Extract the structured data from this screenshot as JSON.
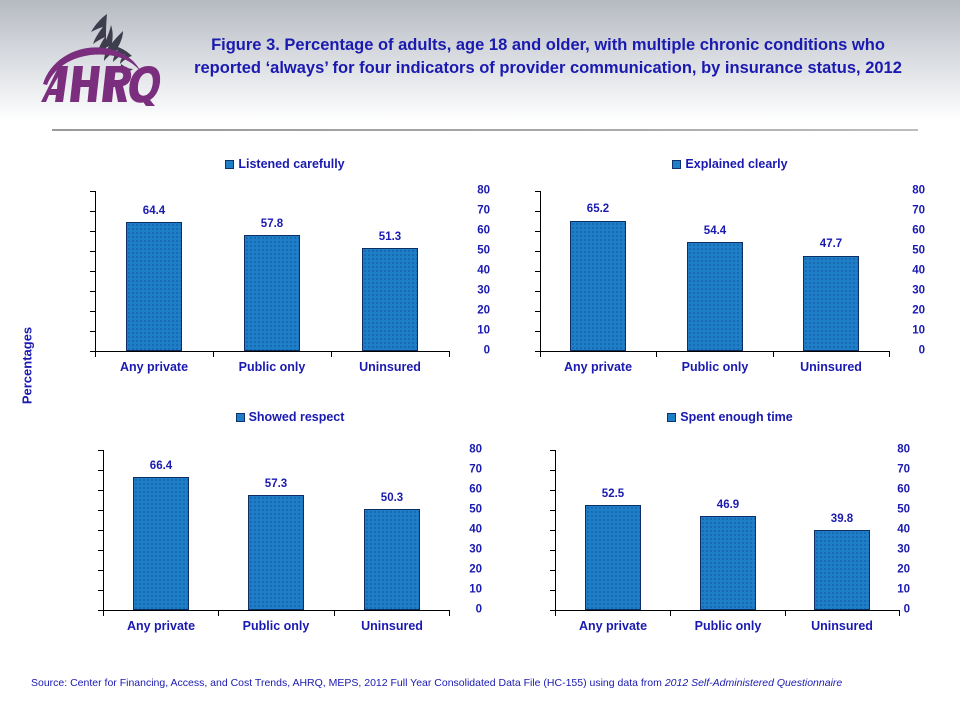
{
  "header": {
    "title": "Figure 3. Percentage of adults, age 18 and older, with multiple chronic conditions who reported ‘always’ for four indicators of provider communication, by insurance status, 2012",
    "logo_alt": "AHRQ",
    "logo_wordmark": "AHRQ",
    "agency_eagle": "hhs-eagle-icon"
  },
  "axis_group_label": "Percentages",
  "source": {
    "prefix": "Source: Center for Financing, Access, and Cost Trends, AHRQ, MEPS, 2012 Full Year Consolidated Data File (HC-155) using data from ",
    "italic": "2012 Self-Administered Questionnaire"
  },
  "colors": {
    "bar_fill": "#1f7ec8",
    "bar_border": "#0d2d63",
    "text_blue": "#1a1ab0",
    "axis": "#000000",
    "header_gradient_top": "#b5b9c1",
    "header_gradient_bottom": "#ffffff",
    "logo_purple": "#7b2d7e"
  },
  "chart_data": [
    {
      "type": "bar",
      "title": "Listened carefully",
      "legend": [
        "Listened carefully"
      ],
      "legend_position": "top-center",
      "categories": [
        "Any private",
        "Public only",
        "Uninsured"
      ],
      "values": [
        64.4,
        57.8,
        51.3
      ],
      "value_labels": [
        "64.4",
        "57.8",
        "51.3"
      ],
      "xlabel": "",
      "ylabel": "Percentages",
      "ylim": [
        0,
        80
      ],
      "yticks": [
        0,
        10,
        20,
        30,
        40,
        50,
        60,
        70,
        80
      ],
      "ytick_labels": [
        "0",
        "10",
        "20",
        "30",
        "40",
        "50",
        "60",
        "70",
        "80"
      ],
      "grid": false
    },
    {
      "type": "bar",
      "title": "Explained clearly",
      "legend": [
        "Explained clearly"
      ],
      "legend_position": "top-center",
      "categories": [
        "Any private",
        "Public only",
        "Uninsured"
      ],
      "values": [
        65.2,
        54.4,
        47.7
      ],
      "value_labels": [
        "65.2",
        "54.4",
        "47.7"
      ],
      "xlabel": "",
      "ylabel": "Percentages",
      "ylim": [
        0,
        80
      ],
      "yticks": [
        0,
        10,
        20,
        30,
        40,
        50,
        60,
        70,
        80
      ],
      "ytick_labels": [
        "0",
        "10",
        "20",
        "30",
        "40",
        "50",
        "60",
        "70",
        "80"
      ],
      "grid": false
    },
    {
      "type": "bar",
      "title": "Showed respect",
      "legend": [
        "Showed respect"
      ],
      "legend_position": "top-center",
      "categories": [
        "Any private",
        "Public only",
        "Uninsured"
      ],
      "values": [
        66.4,
        57.3,
        50.3
      ],
      "value_labels": [
        "66.4",
        "57.3",
        "50.3"
      ],
      "xlabel": "",
      "ylabel": "Percentages",
      "ylim": [
        0,
        80
      ],
      "yticks": [
        0,
        10,
        20,
        30,
        40,
        50,
        60,
        70,
        80
      ],
      "ytick_labels": [
        "0",
        "10",
        "20",
        "30",
        "40",
        "50",
        "60",
        "70",
        "80"
      ],
      "grid": false
    },
    {
      "type": "bar",
      "title": "Spent enough time",
      "legend": [
        "Spent enough time"
      ],
      "legend_position": "top-center",
      "categories": [
        "Any private",
        "Public only",
        "Uninsured"
      ],
      "values": [
        52.5,
        46.9,
        39.8
      ],
      "value_labels": [
        "52.5",
        "46.9",
        "39.8"
      ],
      "xlabel": "",
      "ylabel": "Percentages",
      "ylim": [
        0,
        80
      ],
      "yticks": [
        0,
        10,
        20,
        30,
        40,
        50,
        60,
        70,
        80
      ],
      "ytick_labels": [
        "0",
        "10",
        "20",
        "30",
        "40",
        "50",
        "60",
        "70",
        "80"
      ],
      "grid": false
    }
  ]
}
